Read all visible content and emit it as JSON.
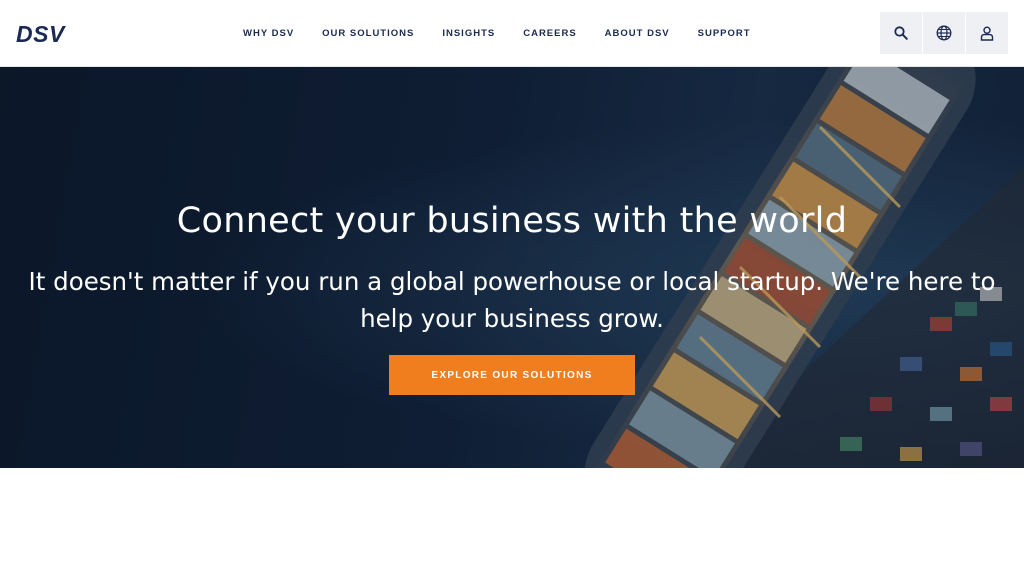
{
  "header": {
    "logo_text": "DSV",
    "nav": [
      "WHY DSV",
      "OUR SOLUTIONS",
      "INSIGHTS",
      "CAREERS",
      "ABOUT DSV",
      "SUPPORT"
    ],
    "tools": [
      {
        "icon": "search-icon"
      },
      {
        "icon": "globe-icon"
      },
      {
        "icon": "user-icon"
      }
    ]
  },
  "hero": {
    "title": "Connect your business with the world",
    "subtitle": "It doesn't matter if you run a global powerhouse or local startup. We're here to help your business grow.",
    "cta_label": "EXPLORE OUR SOLUTIONS"
  },
  "colors": {
    "brand": "#1a2a52",
    "accent": "#f07e1f",
    "hero_bg": "#102038"
  }
}
